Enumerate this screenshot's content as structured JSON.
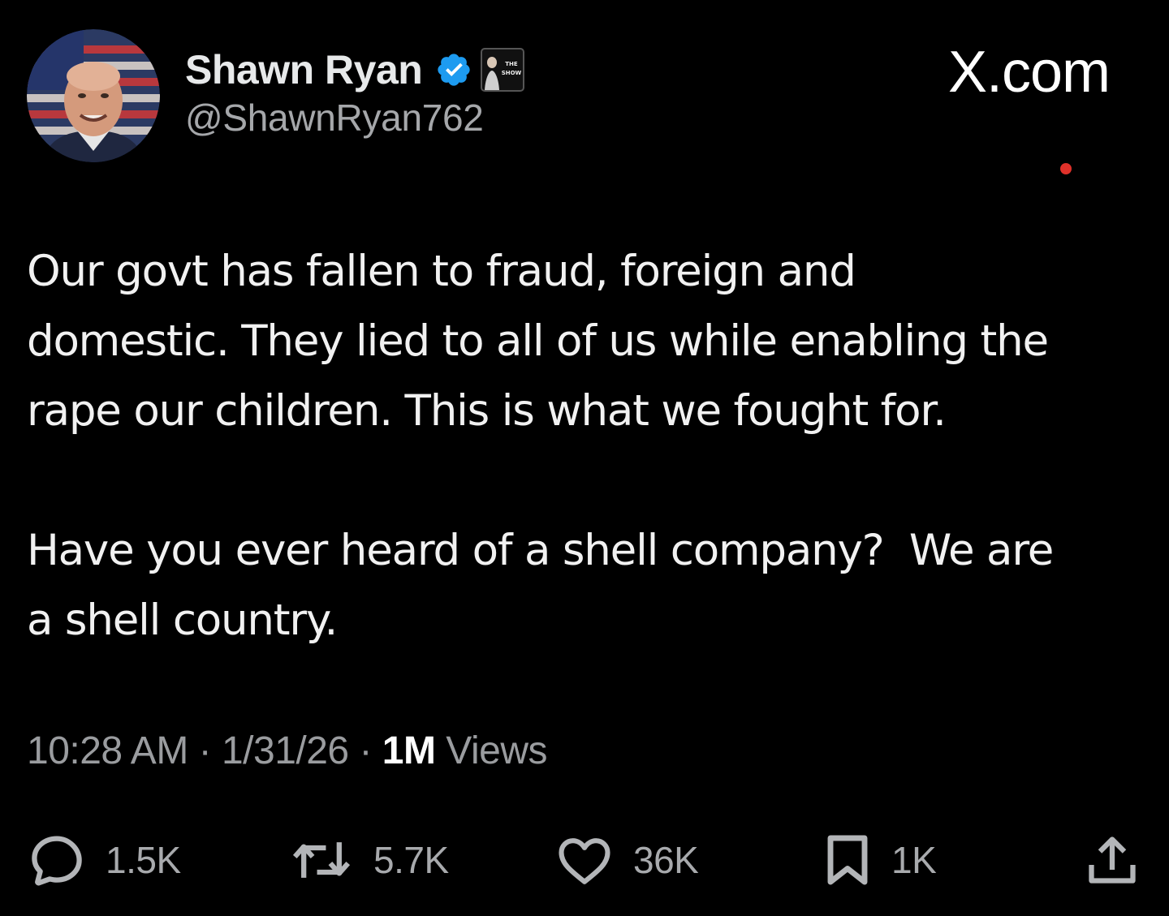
{
  "author": {
    "display_name": "Shawn Ryan",
    "handle": "@ShawnRyan762",
    "verified": true,
    "affiliate_badge_text": "THE SHOW"
  },
  "watermark": "X.com",
  "tweet": {
    "paragraphs": [
      "Our govt has fallen to fraud, foreign and\ndomestic. They lied to all of us while enabling the\nrape our children. This is what we fought for.",
      "Have you ever heard of a shell company?  We are\na shell country."
    ]
  },
  "meta": {
    "time": "10:28 AM",
    "separator": " · ",
    "date": "1/31/26",
    "views_count": "1M",
    "views_label": " Views"
  },
  "actions": {
    "replies": "1.5K",
    "reposts": "5.7K",
    "likes": "36K",
    "bookmarks": "1K"
  },
  "colors": {
    "background": "#000000",
    "text": "#e7e9ea",
    "secondary_text": "#9a9c9f",
    "verified_blue": "#1d9bf0",
    "notification_dot": "#e0312a"
  },
  "icons": {
    "verified": "verified-badge-icon",
    "affiliate": "affiliate-badge-icon",
    "reply": "reply-icon",
    "repost": "repost-icon",
    "like": "heart-icon",
    "bookmark": "bookmark-icon",
    "share": "share-icon"
  }
}
